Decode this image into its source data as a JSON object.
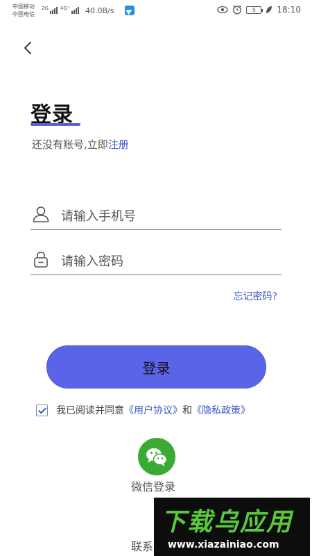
{
  "status_bar": {
    "carrier_1": "中国移动",
    "carrier_2": "中国电信",
    "net_1": "2G",
    "net_2": "4G⁺",
    "speed": "40.0B/s",
    "battery": "5",
    "time": "18:10"
  },
  "page": {
    "title": "登录",
    "subtitle_prefix": "还没有账号,立即",
    "subtitle_link": "注册"
  },
  "form": {
    "phone_placeholder": "请输入手机号",
    "password_placeholder": "请输入密码",
    "forgot_label": "忘记密码?",
    "login_label": "登录"
  },
  "agreement": {
    "prefix": "我已阅读并同意",
    "user_agreement": "《用户协议》",
    "and": "和",
    "privacy_policy": "《隐私政策》",
    "checked": true
  },
  "social": {
    "wechat_label": "微信登录"
  },
  "footer": {
    "contact_label": "联系"
  },
  "watermark": {
    "brand": "下载乌应用",
    "url": "www.xiazainiao.com"
  },
  "colors": {
    "accent": "#5a64e8",
    "link": "#3b57c4",
    "wechat": "#3aaa35"
  }
}
